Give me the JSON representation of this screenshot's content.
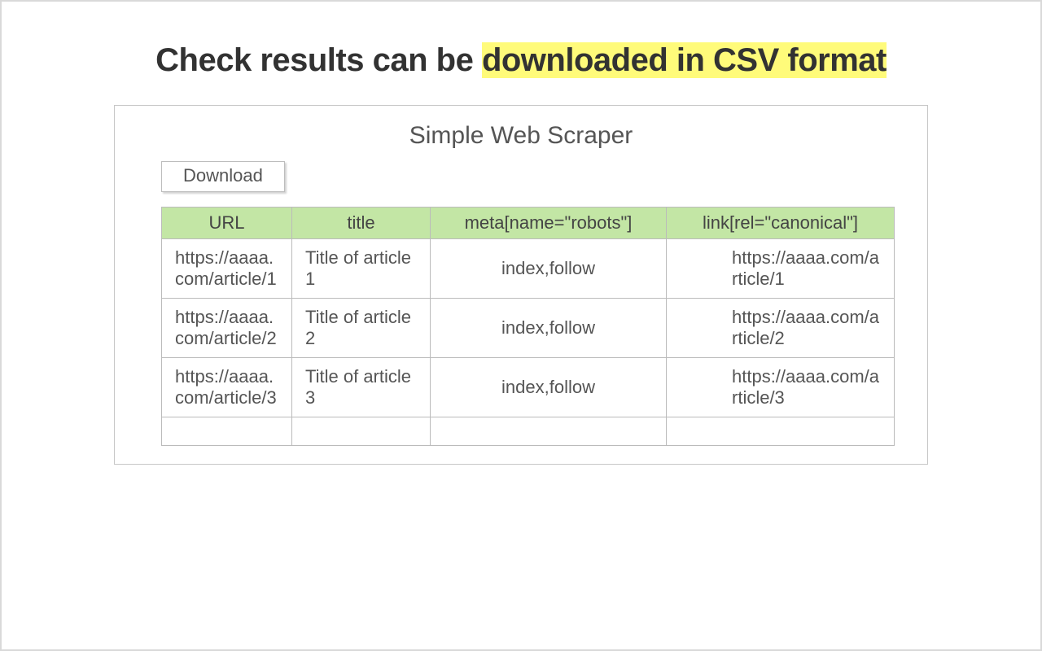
{
  "heading": {
    "prefix": "Check results can be ",
    "highlight": "downloaded in CSV format"
  },
  "panel": {
    "title": "Simple Web Scraper",
    "download_label": "Download"
  },
  "table": {
    "headers": {
      "url": "URL",
      "title": "title",
      "robots": "meta[name=\"robots\"]",
      "canonical": "link[rel=\"canonical\"]"
    },
    "rows": [
      {
        "url": "https://aaaa.com/article/1",
        "title": "Title of article 1",
        "robots": "index,follow",
        "canonical": "https://aaaa.com/article/1"
      },
      {
        "url": "https://aaaa.com/article/2",
        "title": "Title of article 2",
        "robots": "index,follow",
        "canonical": "https://aaaa.com/article/2"
      },
      {
        "url": "https://aaaa.com/article/3",
        "title": "Title of article 3",
        "robots": "index,follow",
        "canonical": "https://aaaa.com/article/3"
      }
    ]
  }
}
